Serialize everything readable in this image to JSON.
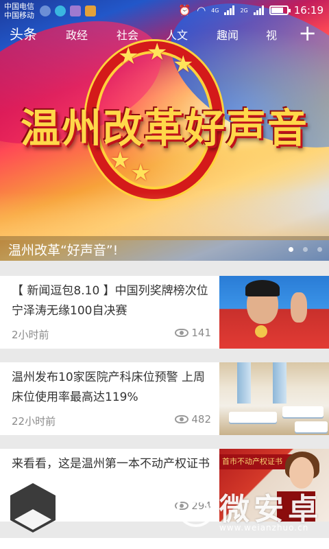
{
  "status_bar": {
    "carrier_1": "中国电信",
    "carrier_2": "中国移动",
    "network_a": "4G",
    "network_b": "2G",
    "time": "16:19",
    "icons": [
      "alarm-icon",
      "wifi-icon",
      "signal-icon",
      "battery-icon"
    ]
  },
  "tabs": {
    "items": [
      "头条",
      "政经",
      "社会",
      "人文",
      "趣闻",
      "视"
    ],
    "active": "头条",
    "add_icon": "plus-icon"
  },
  "banner": {
    "art_text": "温州改革好声音",
    "caption": "温州改革“好声音”!",
    "slide_count": 3,
    "active_slide": 1
  },
  "feed": [
    {
      "title": "【 新闻逗包8.10 】中国列奖牌榜次位 宁泽涛无缘100自决赛",
      "time": "2小时前",
      "views": "141",
      "thumb": "swimmer-photo"
    },
    {
      "title": "温州发布10家医院产科床位预警 上周床位使用率最高达119%",
      "time": "22小时前",
      "views": "482",
      "thumb": "hospital-ward-photo"
    },
    {
      "title": "来看看，这是温州第一本不动产权证书",
      "time": "",
      "views": "294",
      "thumb": "certificate-photo",
      "thumb_text": "首市不动产权证书"
    }
  ],
  "watermark": {
    "text": "微安卓",
    "url": "www.weianzhuo.cn"
  },
  "colors": {
    "accent_red": "#d41a1a",
    "gold": "#ffd84a",
    "text_dark": "#333333",
    "text_meta": "#8a8a8a"
  }
}
